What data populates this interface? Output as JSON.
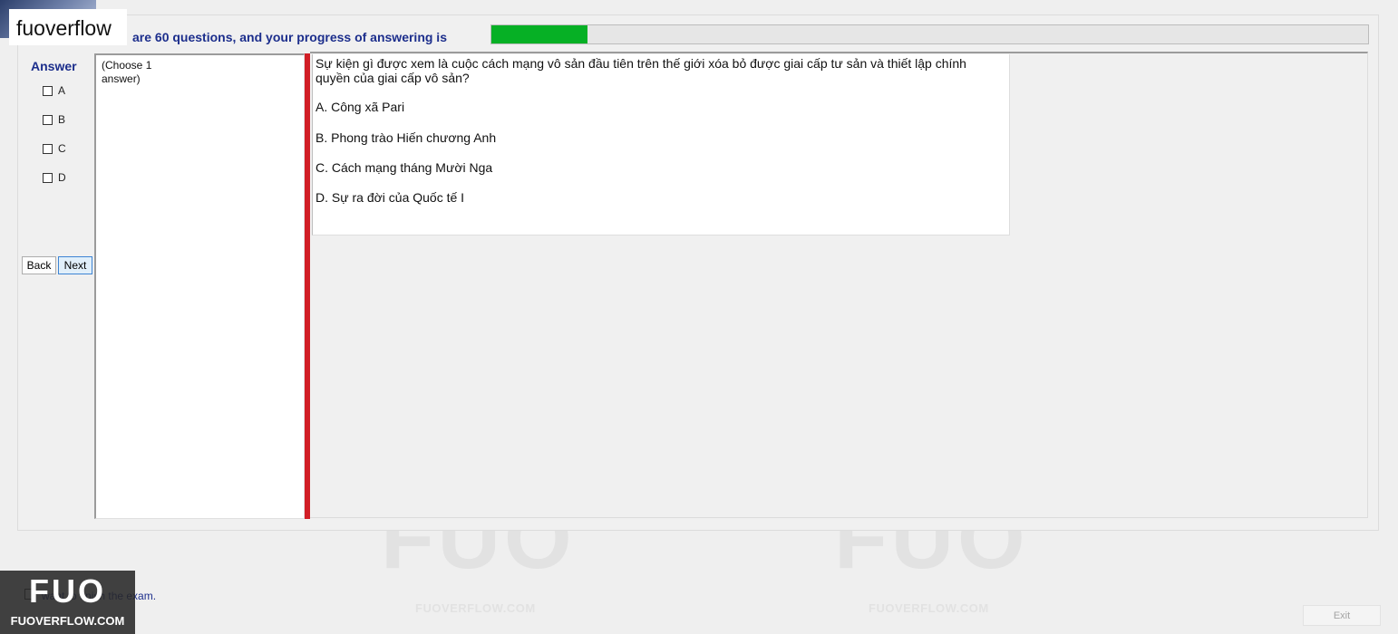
{
  "site": {
    "name": "fuoverflow"
  },
  "progress": {
    "text": "are 60 questions, and your progress of answering is",
    "fraction": 0.11
  },
  "answer": {
    "title": "Answer",
    "options": [
      {
        "label": "A",
        "checked": false
      },
      {
        "label": "B",
        "checked": false
      },
      {
        "label": "C",
        "checked": false
      },
      {
        "label": "D",
        "checked": false
      }
    ]
  },
  "nav": {
    "back_label": "Back",
    "next_label": "Next"
  },
  "instruction": {
    "text": "(Choose 1 answer)"
  },
  "question": {
    "text": "Sự kiện gì được xem là cuộc cách mạng vô sản đầu tiên trên thế giới xóa bỏ được giai cấp tư sản và thiết lập chính quyền của giai cấp vô sản?",
    "choices": [
      "A.  Công xã Pari",
      "B.  Phong trào Hiến chương Anh",
      "C.  Cách mạng tháng Mười Nga",
      "D.  Sự ra đời của Quốc tế I"
    ]
  },
  "footer": {
    "finish_label": "want to finish the exam.",
    "exit_label": "Exit",
    "logo_mark": "FUO",
    "logo_text": "FUOVERFLOW.COM"
  },
  "watermark": {
    "mark": "FUO",
    "text": "FUOVERFLOW.COM"
  },
  "colors": {
    "accent": "#1c2e8c",
    "progress": "#06b025",
    "splitter": "#d11e26"
  }
}
